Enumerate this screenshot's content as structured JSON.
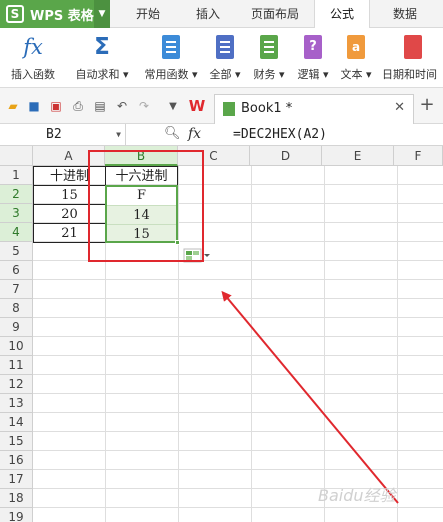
{
  "app": {
    "title": "WPS 表格",
    "logo_letter": "S"
  },
  "menu_tabs": [
    "开始",
    "插入",
    "页面布局",
    "公式",
    "数据"
  ],
  "active_tab": "公式",
  "ribbon": [
    {
      "label": "插入函数",
      "icon": "fx-icon"
    },
    {
      "label": "自动求和",
      "icon": "sigma-icon",
      "dropdown": true
    },
    {
      "label": "常用函数",
      "icon": "star-book-icon",
      "dropdown": true
    },
    {
      "label": "全部",
      "icon": "list-book-icon",
      "dropdown": true
    },
    {
      "label": "财务",
      "icon": "finance-book-icon",
      "dropdown": true
    },
    {
      "label": "逻辑",
      "icon": "question-book-icon",
      "dropdown": true
    },
    {
      "label": "文本",
      "icon": "text-book-icon",
      "dropdown": true
    },
    {
      "label": "日期和时间",
      "icon": "clock-book-icon",
      "dropdown": true
    }
  ],
  "document": {
    "name": "Book1 *"
  },
  "formula_bar": {
    "cell_ref": "B2",
    "fx": "fx",
    "formula": "=DEC2HEX(A2)"
  },
  "grid": {
    "columns": [
      "A",
      "B",
      "C",
      "D",
      "E",
      "F"
    ],
    "selected_column": "B",
    "rows": [
      "1",
      "2",
      "3",
      "4",
      "5",
      "6",
      "7",
      "8",
      "9",
      "10",
      "11",
      "12",
      "13",
      "14",
      "15",
      "16",
      "17",
      "18",
      "19"
    ],
    "selected_rows": [
      "2",
      "3",
      "4"
    ],
    "data": [
      {
        "a": "十进制",
        "b": "十六进制"
      },
      {
        "a": "15",
        "b": "F"
      },
      {
        "a": "20",
        "b": "14"
      },
      {
        "a": "21",
        "b": "15"
      }
    ]
  },
  "watermark": "Baidu经验",
  "colors": {
    "brand_green": "#5aa64a",
    "annotation_red": "#e0282e",
    "selection_fill": "#e7f2e1"
  }
}
